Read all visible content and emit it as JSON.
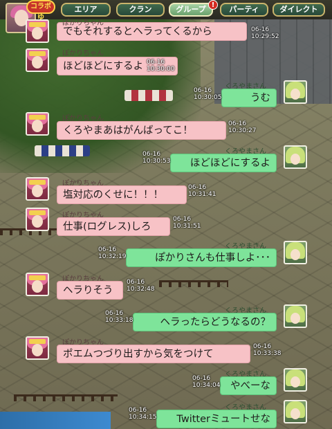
{
  "nav": {
    "collab_badge": "コラボゆ",
    "notification_mark": "!",
    "tabs": [
      {
        "label": "エリア"
      },
      {
        "label": "クラン"
      },
      {
        "label": "グループ"
      },
      {
        "label": "パーティ"
      },
      {
        "label": "ダイレクト"
      }
    ],
    "active_tab": "グループ"
  },
  "colors": {
    "left_bubble": "#f7c2c6",
    "right_bubble": "#7ee49a",
    "active_tab": "#a7d2a5"
  },
  "messages": [
    {
      "side": "left",
      "sender": "ぽかりちゃん",
      "text": "でもそれするとヘラってくるから",
      "date": "06-16",
      "time": "10:29:52"
    },
    {
      "side": "left",
      "sender": "ぽかりちゃん",
      "text": "ほどほどにするよ",
      "date": "06-16",
      "time": "10:30:00"
    },
    {
      "side": "right",
      "sender": "くろやまさん",
      "text": "うむ",
      "date": "06-16",
      "time": "10:30:05"
    },
    {
      "side": "left",
      "sender": "ぽかりちゃん",
      "text": "くろやまあはがんばってこ！",
      "date": "06-16",
      "time": "10:30:27"
    },
    {
      "side": "right",
      "sender": "くろやまさん",
      "text": "ほどほどにするよ",
      "date": "06-16",
      "time": "10:30:53"
    },
    {
      "side": "left",
      "sender": "ぽかりちゃん",
      "text": "塩対応のくせに！！！",
      "date": "06-16",
      "time": "10:31:41"
    },
    {
      "side": "left",
      "sender": "ぽかりちゃん",
      "text": "仕事(ログレス)しろ",
      "date": "06-16",
      "time": "10:31:51"
    },
    {
      "side": "right",
      "sender": "くろやまさん",
      "text": "ぽかりさんも仕事しよ･･･",
      "date": "06-16",
      "time": "10:32:19"
    },
    {
      "side": "left",
      "sender": "ぽかりちゃん",
      "text": "ヘラりそう",
      "date": "06-16",
      "time": "10:32:48"
    },
    {
      "side": "right",
      "sender": "くろやまさん",
      "text": "ヘラったらどうなるの？",
      "date": "06-16",
      "time": "10:33:18"
    },
    {
      "side": "left",
      "sender": "ぽかりちゃん",
      "text": "ポエムつづり出すから気をつけて",
      "date": "06-16",
      "time": "10:33:38"
    },
    {
      "side": "right",
      "sender": "くろやまさん",
      "text": "やべーな",
      "date": "06-16",
      "time": "10:34:04"
    },
    {
      "side": "right",
      "sender": "くろやまさん",
      "text": "Twitterミュートせな",
      "date": "06-16",
      "time": "10:34:15"
    }
  ]
}
